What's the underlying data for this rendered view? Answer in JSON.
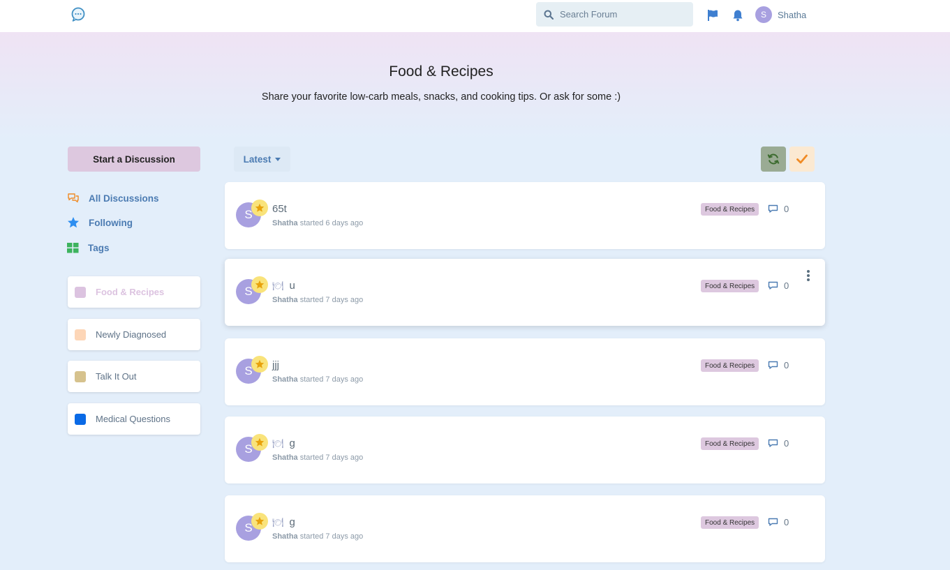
{
  "header": {
    "search_placeholder": "Search Forum",
    "username": "Shatha",
    "avatar_letter": "S",
    "icons": [
      "chat-logo-icon",
      "search-icon",
      "flag-icon",
      "bell-icon"
    ]
  },
  "hero": {
    "title": "Food & Recipes",
    "description": "Share your favorite low-carb meals, snacks, and cooking tips. Or ask for some :)"
  },
  "sidebar": {
    "start_label": "Start a Discussion",
    "nav": [
      {
        "label": "All Discussions",
        "icon": "chat-bubbles-icon"
      },
      {
        "label": "Following",
        "icon": "star-icon"
      },
      {
        "label": "Tags",
        "icon": "grid-icon"
      }
    ],
    "tags": [
      {
        "label": "Food & Recipes",
        "color": "#dcc3e0",
        "active": true
      },
      {
        "label": "Newly Diagnosed",
        "color": "#fdd6b7",
        "active": false
      },
      {
        "label": "Talk It Out",
        "color": "#d6c28d",
        "active": false
      },
      {
        "label": "Medical Questions",
        "color": "#0a6ae6",
        "active": false
      }
    ]
  },
  "toolbar": {
    "sort_label": "Latest",
    "refresh_icon": "refresh-icon",
    "mark_read_icon": "check-icon"
  },
  "discussions": [
    {
      "title": "65t",
      "emoji": "",
      "author": "Shatha",
      "action": "started 6 days ago",
      "tag": "Food & Recipes",
      "replies": "0",
      "avatar": "S"
    },
    {
      "title": "u",
      "emoji": "🍽",
      "author": "Shatha",
      "action": "started 7 days ago",
      "tag": "Food & Recipes",
      "replies": "0",
      "avatar": "S"
    },
    {
      "title": "jjj",
      "emoji": "",
      "author": "Shatha",
      "action": "started 7 days ago",
      "tag": "Food & Recipes",
      "replies": "0",
      "avatar": "S"
    },
    {
      "title": "g",
      "emoji": "🍽",
      "author": "Shatha",
      "action": "started 7 days ago",
      "tag": "Food & Recipes",
      "replies": "0",
      "avatar": "S"
    },
    {
      "title": "g",
      "emoji": "🍽",
      "author": "Shatha",
      "action": "started 7 days ago",
      "tag": "Food & Recipes",
      "replies": "0",
      "avatar": "S"
    }
  ]
}
